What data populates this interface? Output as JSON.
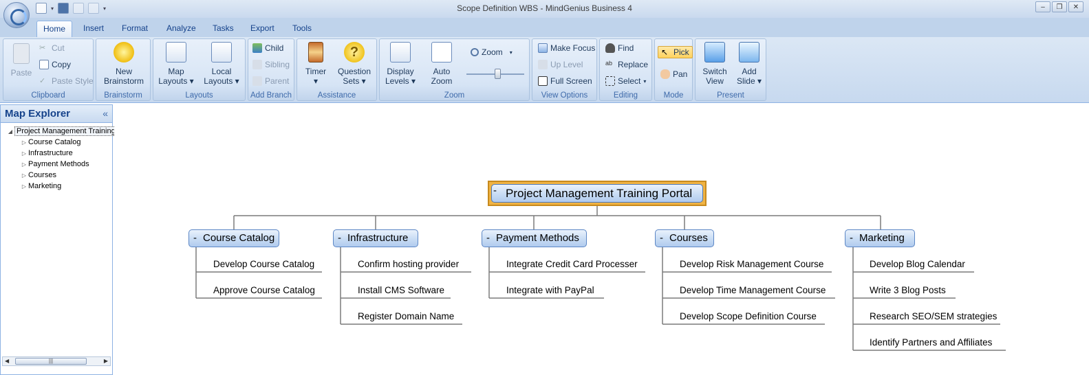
{
  "window": {
    "title": "Scope Definition WBS - MindGenius Business 4"
  },
  "tabs": [
    "Home",
    "Insert",
    "Format",
    "Analyze",
    "Tasks",
    "Export",
    "Tools"
  ],
  "ribbon": {
    "clipboard": {
      "label": "Clipboard",
      "paste": "Paste",
      "cut": "Cut",
      "copy": "Copy",
      "paste_style": "Paste Style"
    },
    "brainstorm": {
      "label": "Brainstorm",
      "new_line1": "New",
      "new_line2": "Brainstorm"
    },
    "layouts": {
      "label": "Layouts",
      "map_line1": "Map",
      "map_line2": "Layouts",
      "local_line1": "Local",
      "local_line2": "Layouts"
    },
    "add_branch": {
      "label": "Add Branch",
      "child": "Child",
      "sibling": "Sibling",
      "parent": "Parent"
    },
    "assistance": {
      "label": "Assistance",
      "timer": "Timer",
      "question_line1": "Question",
      "question_line2": "Sets"
    },
    "zoom": {
      "label": "Zoom",
      "display_line1": "Display",
      "display_line2": "Levels",
      "auto_line1": "Auto",
      "auto_line2": "Zoom",
      "zoom": "Zoom",
      "zoom_level": 0.55
    },
    "view_options": {
      "label": "View Options",
      "make_focus": "Make Focus",
      "up_level": "Up Level",
      "full_screen": "Full Screen"
    },
    "editing": {
      "label": "Editing",
      "find": "Find",
      "replace": "Replace",
      "select": "Select"
    },
    "mode": {
      "label": "Mode",
      "pick": "Pick",
      "pan": "Pan"
    },
    "present": {
      "label": "Present",
      "switch_line1": "Switch",
      "switch_line2": "View",
      "add_line1": "Add",
      "add_line2": "Slide"
    }
  },
  "explorer": {
    "title": "Map Explorer",
    "collapse": "«",
    "root": "Project Management Training Portal",
    "children": [
      "Course Catalog",
      "Infrastructure",
      "Payment Methods",
      "Courses",
      "Marketing"
    ]
  },
  "map": {
    "root": "Project Management Training Portal",
    "branches": [
      {
        "label": "Course Catalog",
        "items": [
          "Develop Course Catalog",
          "Approve Course Catalog"
        ]
      },
      {
        "label": "Infrastructure",
        "items": [
          "Confirm hosting provider",
          "Install CMS Software",
          "Register Domain Name"
        ]
      },
      {
        "label": "Payment Methods",
        "items": [
          "Integrate Credit Card Processer",
          "Integrate with PayPal"
        ]
      },
      {
        "label": "Courses",
        "items": [
          "Develop Risk Management Course",
          "Develop Time Management Course",
          "Develop Scope Definition Course"
        ]
      },
      {
        "label": "Marketing",
        "items": [
          "Develop Blog Calendar",
          "Write 3 Blog Posts",
          "Research SEO/SEM strategies",
          "Identify Partners and Affiliates"
        ]
      }
    ]
  }
}
